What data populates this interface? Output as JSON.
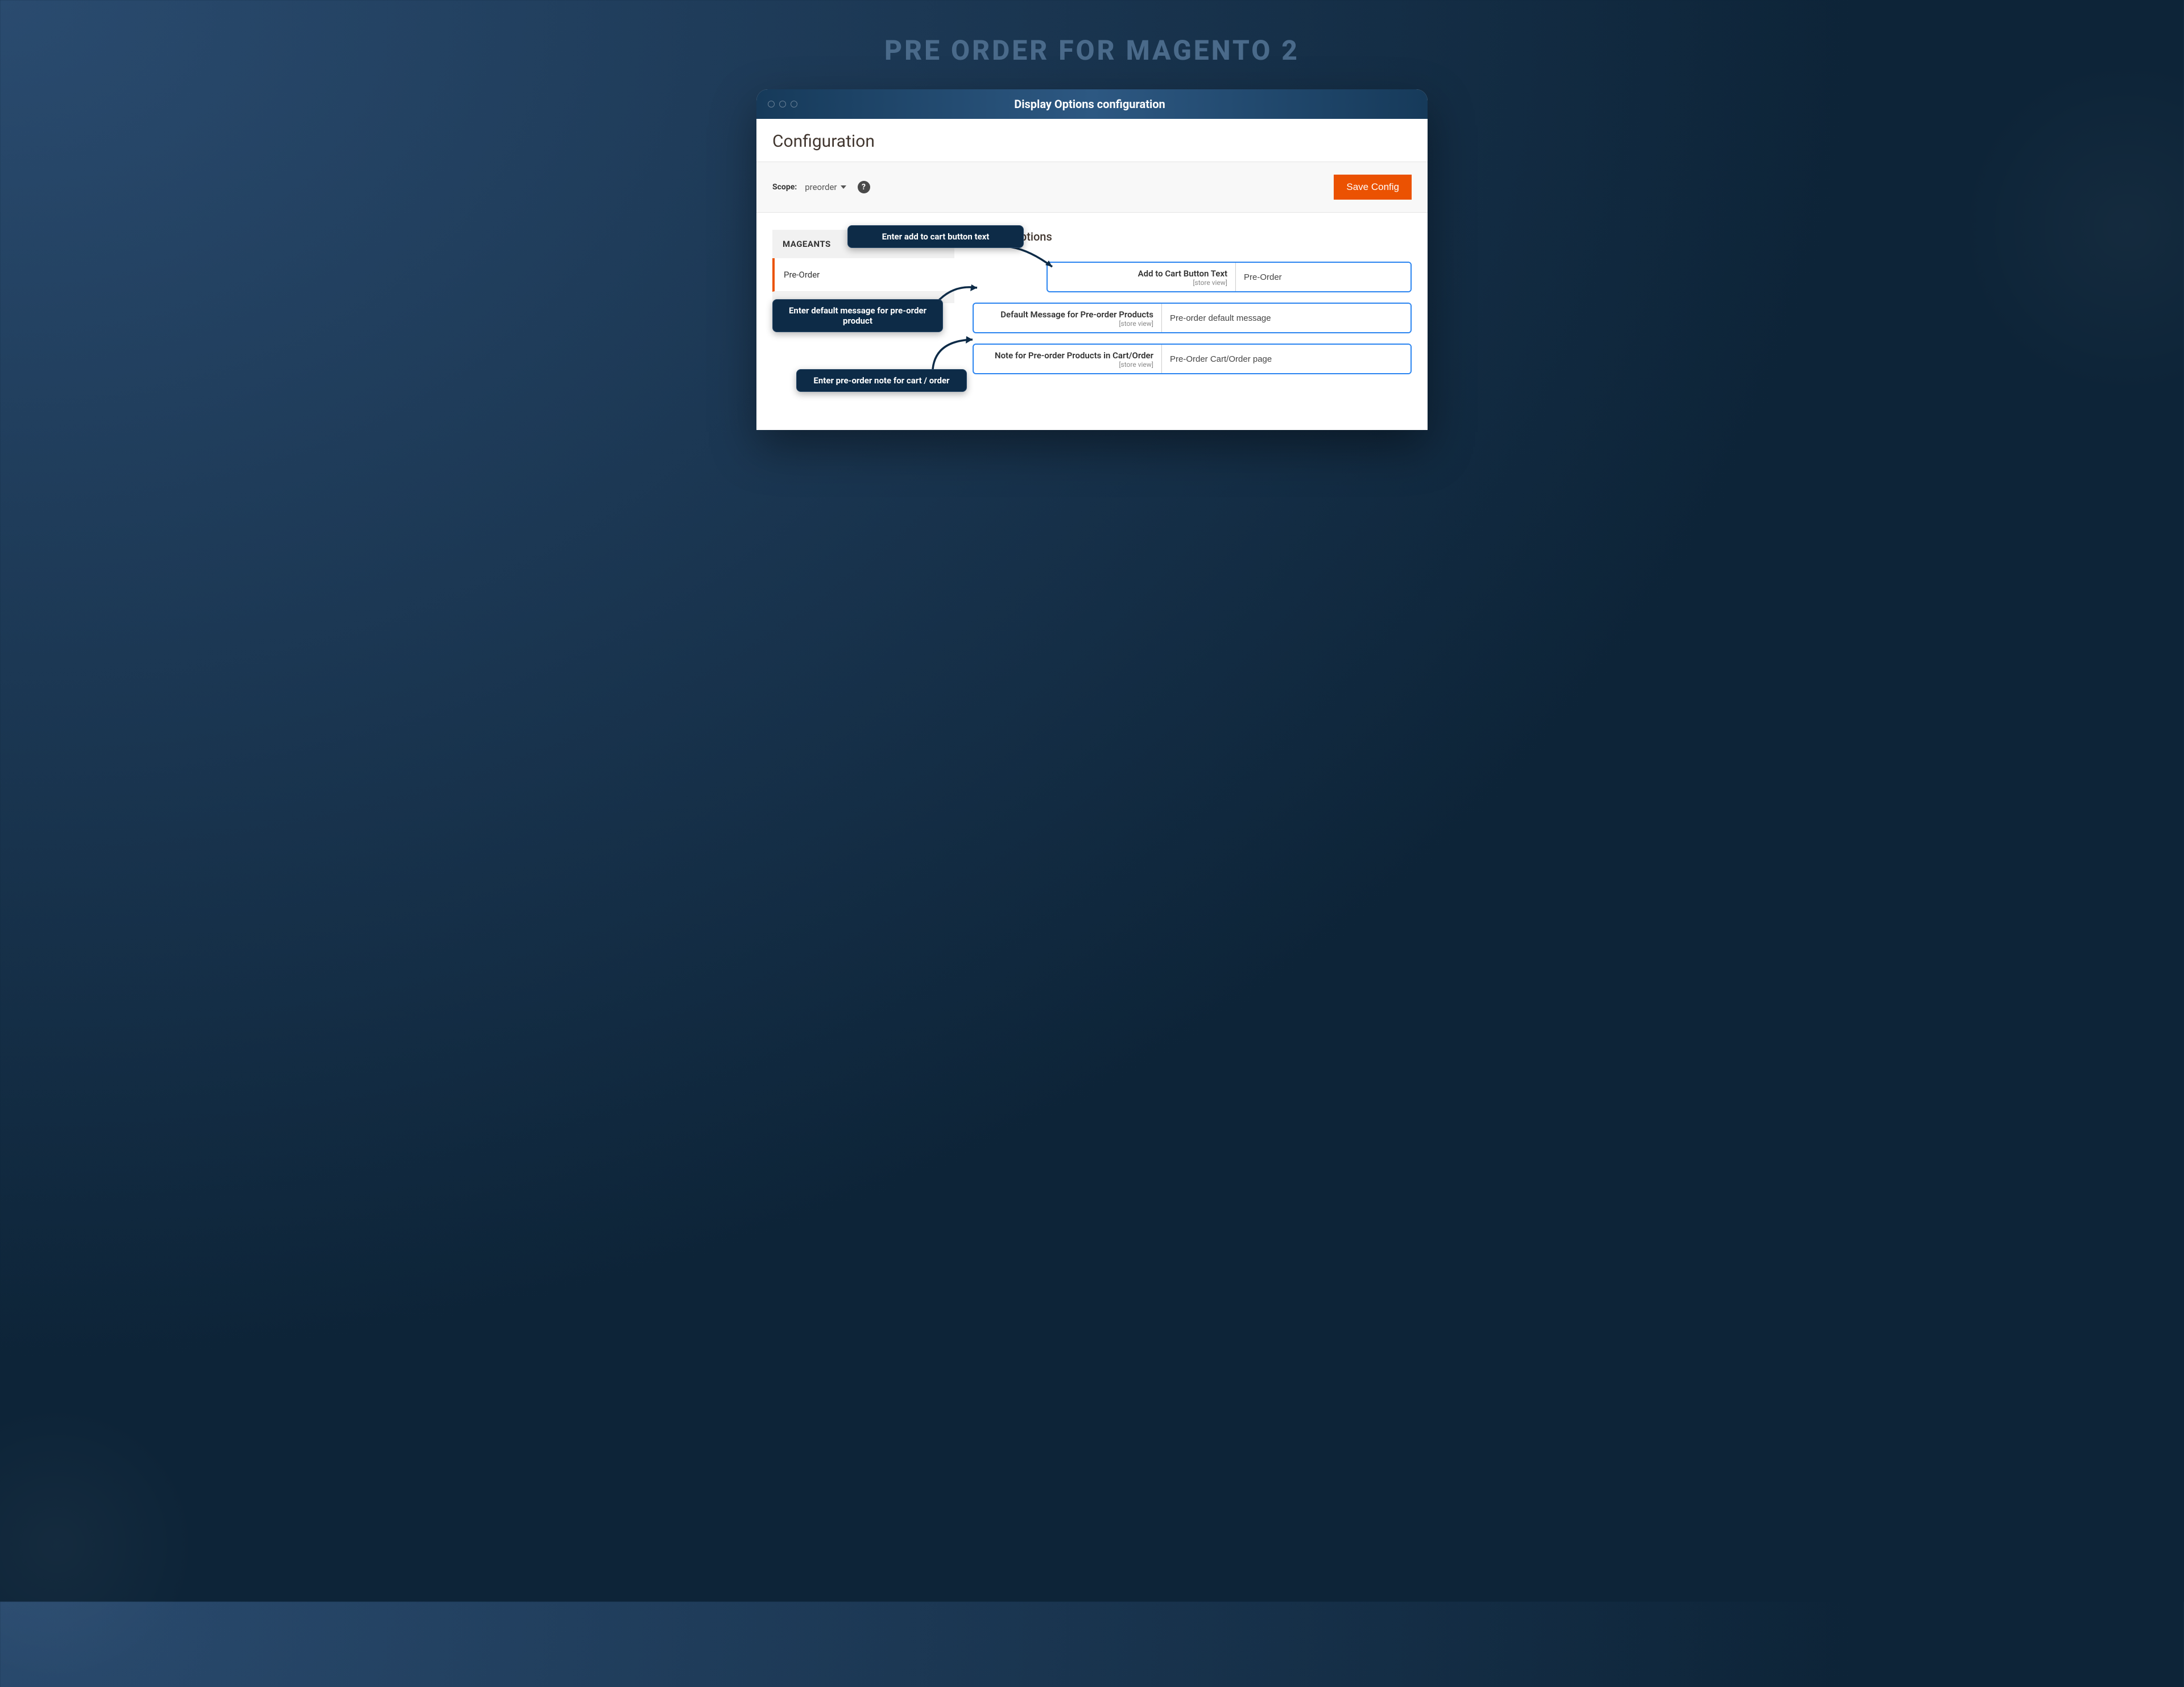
{
  "hero": {
    "title": "PRE ORDER FOR MAGENTO 2"
  },
  "window": {
    "title": "Display Options configuration"
  },
  "page": {
    "title": "Configuration"
  },
  "toolbar": {
    "scope_label": "Scope:",
    "scope_value": "preorder",
    "save_label": "Save Config"
  },
  "sidebar": {
    "section": "MAGEANTS",
    "active_item": "Pre-Order"
  },
  "section_heading": "Display Options",
  "fields": [
    {
      "label": "Add to Cart Button Text",
      "scope": "[store view]",
      "value": "Pre-Order"
    },
    {
      "label": "Default Message for Pre-order Products",
      "scope": "[store view]",
      "value": "Pre-order default message"
    },
    {
      "label": "Note for Pre-order Products in Cart/Order",
      "scope": "[store view]",
      "value": "Pre-Order Cart/Order page"
    }
  ],
  "callouts": {
    "c1": "Enter add to cart button text",
    "c2": "Enter default message for pre-order product",
    "c3": "Enter pre-order note for cart / order"
  },
  "colors": {
    "accent": "#eb5202",
    "highlight": "#2a84f0",
    "callout_bg": "#0d2b47"
  }
}
